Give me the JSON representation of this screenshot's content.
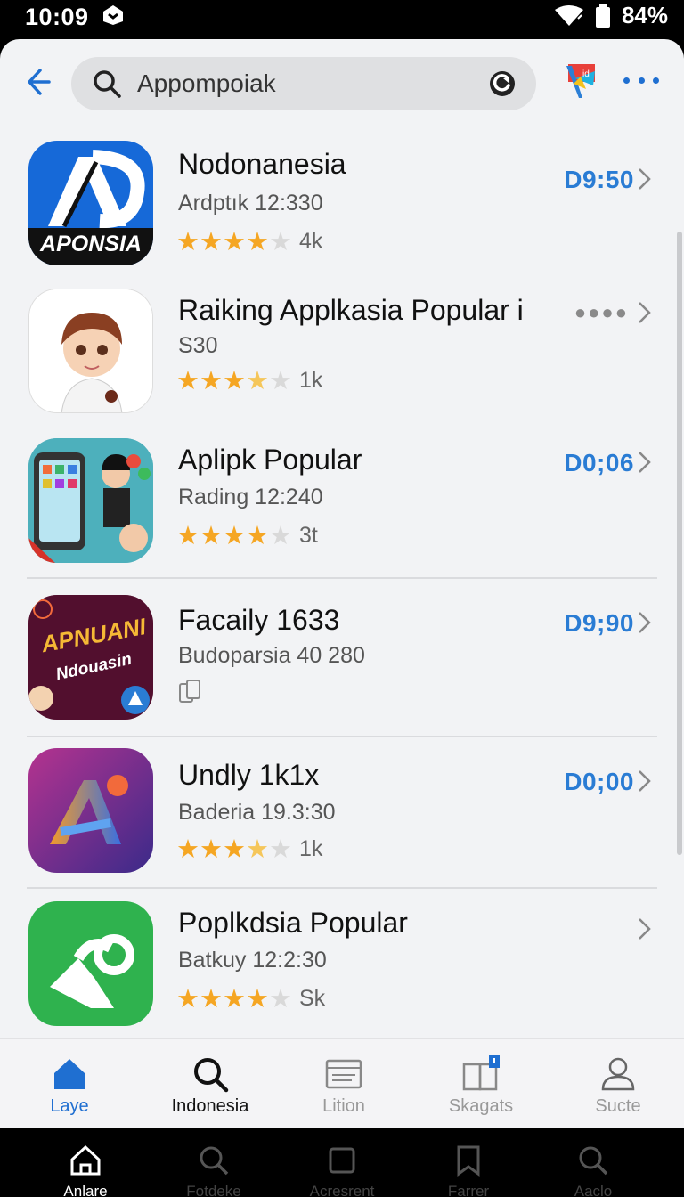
{
  "status_bar": {
    "time": "10:09",
    "battery": "84%"
  },
  "search": {
    "query": "Appompoiak"
  },
  "apps": [
    {
      "title": "Nodonanesia",
      "subtitle": "Ardptık 12:330",
      "price": "D9:50",
      "rating": 4,
      "rating_count": "4k",
      "icon": "aponsia-logo",
      "icon_text": "APONSIA"
    },
    {
      "title": "Raiking Applkasia Popular i",
      "subtitle": "S30",
      "price": "",
      "rating": 3.5,
      "rating_count": "1k",
      "icon": "avatar-icon"
    },
    {
      "title": "Aplipk Popular",
      "subtitle": "Rading 12:240",
      "price": "D0;06",
      "rating": 4,
      "rating_count": "3t",
      "icon": "phone-game-icon"
    },
    {
      "title": "Facaily 1633",
      "subtitle": "Budoparsia 40 280",
      "price": "D9;90",
      "rating": null,
      "rating_count": "",
      "icon": "apnuani-logo",
      "icon_text_top": "APNUANI",
      "icon_text_bottom": "Ndouasin"
    },
    {
      "title": "Undly 1k1x",
      "subtitle": "Baderia 19.3:30",
      "price": "D0;00",
      "rating": 3.5,
      "rating_count": "1k",
      "icon": "letter-a-icon"
    },
    {
      "title": "Poplkdsia Popular",
      "subtitle": "Batkuy 12:2:30",
      "price": "",
      "rating": 4,
      "rating_count": "Sk",
      "icon": "green-phone-icon"
    }
  ],
  "tabs": [
    {
      "label": "Laye",
      "icon": "home-icon",
      "active": true
    },
    {
      "label": "Indonesia",
      "icon": "search-icon",
      "active": false
    },
    {
      "label": "Lition",
      "icon": "list-icon",
      "active": false
    },
    {
      "label": "Skagats",
      "icon": "book-icon",
      "active": false
    },
    {
      "label": "Sucte",
      "icon": "person-icon",
      "active": false
    }
  ],
  "nav": [
    {
      "label": "Anlare",
      "icon": "home-icon",
      "active": true
    },
    {
      "label": "Fotdeke",
      "icon": "search-icon",
      "active": false
    },
    {
      "label": "Acresrent",
      "icon": "square-icon",
      "active": false
    },
    {
      "label": "Farrer",
      "icon": "bookmark-icon",
      "active": false
    },
    {
      "label": "Aaclo",
      "icon": "search-icon",
      "active": false
    }
  ],
  "colors": {
    "accent": "#1f6fd1",
    "price": "#2a7cd4",
    "star": "#f5a623"
  }
}
